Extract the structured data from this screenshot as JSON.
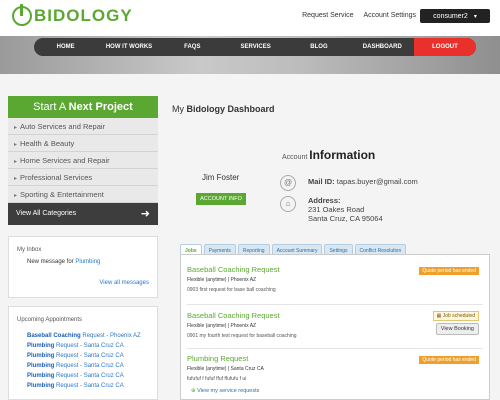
{
  "header": {
    "logo_text": "BIDOLOGY",
    "request_service": "Request Service",
    "account_settings": "Account Settings",
    "user": "consumer2"
  },
  "nav": [
    "HOME",
    "HOW IT WORKS",
    "FAQS",
    "SERVICES",
    "BLOG",
    "DASHBOARD",
    "LOGOUT"
  ],
  "sidebar": {
    "start_prefix": "Start A ",
    "start_bold": "Next Project",
    "categories": [
      "Auto Services and Repair",
      "Health & Beauty",
      "Home Services and Repair",
      "Professional Services",
      "Sporting & Entertainment"
    ],
    "view_all": "View All Categories"
  },
  "inbox": {
    "title": "My Inbox",
    "msg_prefix": "New message for ",
    "msg_link": "Plumbing",
    "view_all": "View all messages"
  },
  "upcoming": {
    "title": "Upcoming Appointments",
    "items": [
      {
        "k": "Baseball Coaching",
        "rest": " Request - Phoenix AZ"
      },
      {
        "k": "Plumbing",
        "rest": " Request - Santa Cruz CA"
      },
      {
        "k": "Plumbing",
        "rest": " Request - Santa Cruz CA"
      },
      {
        "k": "Plumbing",
        "rest": " Request - Santa Cruz CA"
      },
      {
        "k": "Plumbing",
        "rest": " Request - Santa Cruz CA"
      },
      {
        "k": "Plumbing",
        "rest": " Request - Santa Cruz CA"
      }
    ]
  },
  "dashboard": {
    "title_prefix": "My ",
    "title_bold": "Bidology Dashboard",
    "acct_prefix": "Account ",
    "acct_bold": "Information",
    "name": "Jim Foster",
    "account_info_btn": "ACCOUNT INFO",
    "mail_label": "Mail ID:",
    "mail": "tapas.buyer@gmail.com",
    "address_label": "Address:",
    "address_line1": "231 Oakes Road",
    "address_line2": "Santa Cruz, CA 95064"
  },
  "tabs": [
    "Jobs",
    "Payments",
    "Reporting",
    "Account Summary",
    "Settings",
    "Conflict Resolution"
  ],
  "jobs": [
    {
      "title": "Baseball Coaching Request",
      "meta": "Flexible (anytime) | Phoenix AZ",
      "desc": "0903 first request for base ball coaching",
      "badge": "Quote period has ended"
    },
    {
      "title": "Baseball Coaching Request",
      "meta": "Flexible (anytime) | Phoenix AZ",
      "desc": "0901 my fourth test request for baseball coaching",
      "badge": "Job scheduled",
      "button": "View Booking"
    },
    {
      "title": "Plumbing Request",
      "meta": "Flexible (anytime) | Santa Cruz CA",
      "desc": "fufufuf f fufuf ffuf ffufufu f ui",
      "badge": "Quote period has ended"
    }
  ],
  "more_link": "View my service requests"
}
